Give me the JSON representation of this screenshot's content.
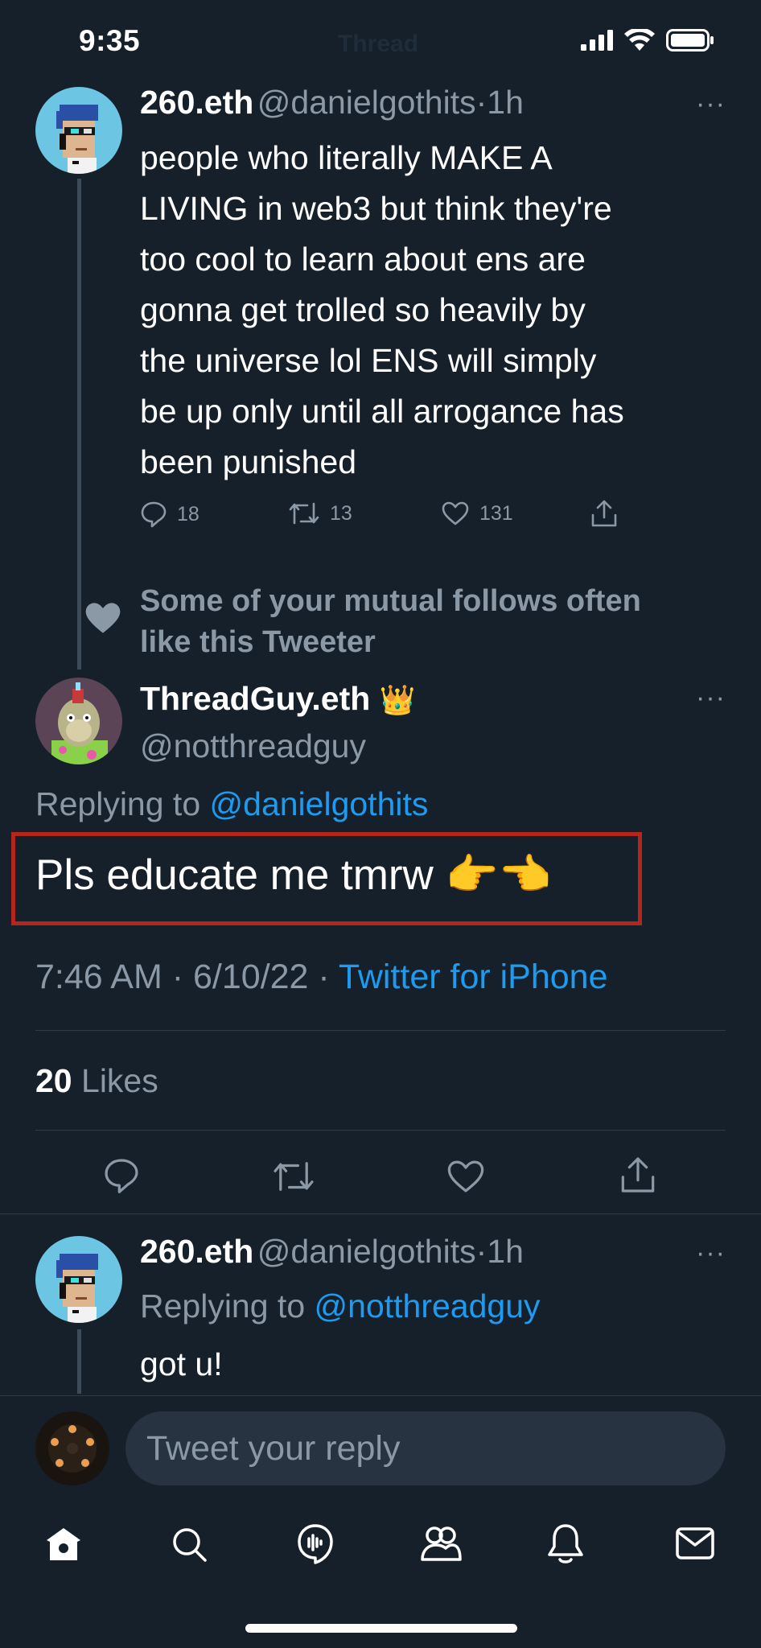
{
  "status_bar": {
    "time": "9:35",
    "ghost_title": "Thread"
  },
  "tweet1": {
    "name": "260.eth",
    "handle": "@danielgothits",
    "dot": "·",
    "time": "1h",
    "more": "···",
    "lines": [
      "people who literally MAKE A",
      "LIVING in web3 but think they're",
      "too cool to learn about ens are",
      "gonna get trolled so heavily by",
      "the universe lol ENS will simply",
      "be up only until all arrogance has",
      "been punished"
    ],
    "actions": {
      "replies": "18",
      "retweets": "13",
      "likes": "131"
    }
  },
  "social_context": {
    "line1": "Some of your mutual follows often",
    "line2": "like this Tweeter"
  },
  "main_tweet": {
    "name": "ThreadGuy.eth",
    "badge": "👑",
    "handle": "@notthreadguy",
    "more": "···",
    "replying_prefix": "Replying to",
    "replying_to": "@danielgothits",
    "text": "Pls educate me tmrw 👉👈",
    "time": "7:46 AM",
    "date": "6/10/22",
    "sep": "·",
    "source": "Twitter for iPhone",
    "likes_count": "20",
    "likes_label": "Likes"
  },
  "reply_tweet": {
    "name": "260.eth",
    "handle": "@danielgothits",
    "dot": "·",
    "time": "1h",
    "more": "···",
    "replying_prefix": "Replying to",
    "replying_to": "@notthreadguy",
    "text": "got u!"
  },
  "composer": {
    "placeholder": "Tweet your reply"
  },
  "tab_bar": {
    "icons": [
      "home-icon",
      "search-icon",
      "spaces-icon",
      "communities-icon",
      "notifications-icon",
      "messages-icon"
    ]
  },
  "colors": {
    "background": "#15202b",
    "link": "#1d9bf0",
    "muted": "#8b98a5",
    "highlight_box": "#b3261e"
  }
}
